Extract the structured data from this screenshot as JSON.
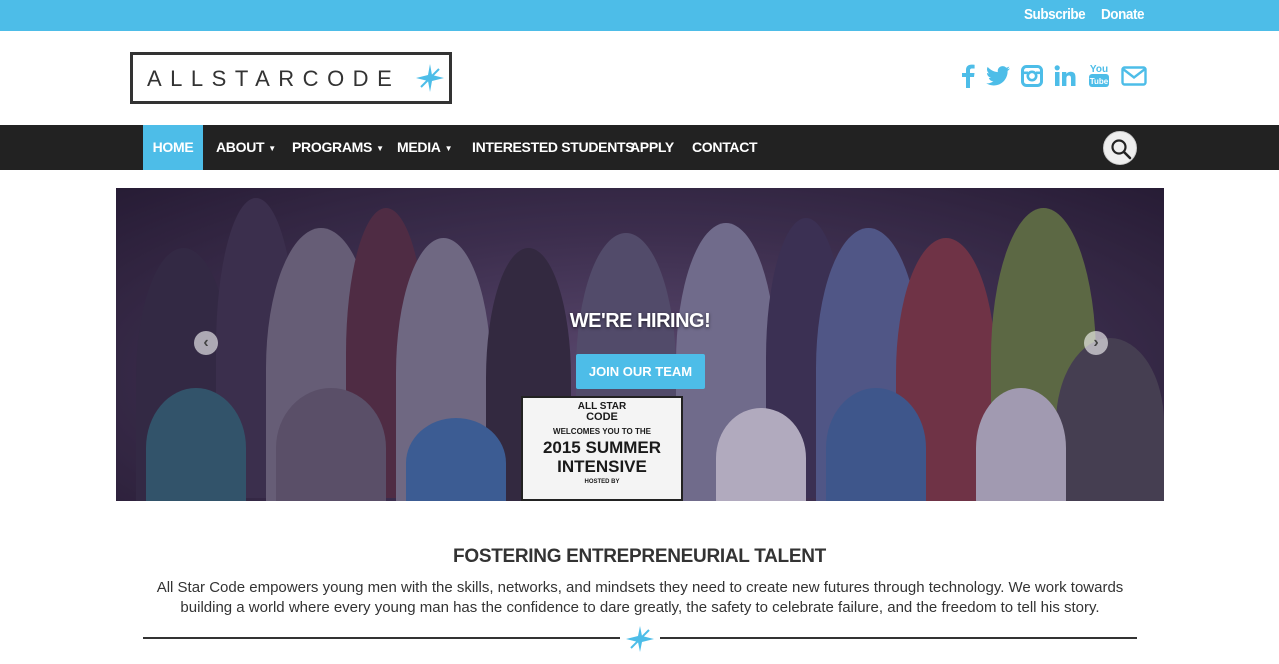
{
  "topbar": {
    "subscribe": "Subscribe",
    "donate": "Donate"
  },
  "logo": {
    "text": "ALLSTARCODE"
  },
  "social": [
    "facebook",
    "twitter",
    "instagram",
    "linkedin",
    "youtube",
    "email"
  ],
  "nav": {
    "items": [
      {
        "label": "Home",
        "active": true
      },
      {
        "label": "About",
        "dropdown": true
      },
      {
        "label": "Programs",
        "dropdown": true
      },
      {
        "label": "Media",
        "dropdown": true
      },
      {
        "label": "Interested Students"
      },
      {
        "label": "Apply"
      },
      {
        "label": "Contact"
      }
    ]
  },
  "hero": {
    "title": "WE'RE HIRING!",
    "button": "JOIN OUR TEAM",
    "sign": {
      "brand_top": "ALL STAR",
      "brand_bottom": "CODE",
      "welcome": "WELCOMES YOU TO THE",
      "line1": "2015 SUMMER",
      "line2": "INTENSIVE",
      "hosted": "HOSTED BY"
    }
  },
  "section": {
    "title": "FOSTERING ENTREPRENEURIAL TALENT",
    "body": "All Star Code empowers young men with the skills, networks, and mindsets they need to create new futures through technology. We work towards building a world where every young man has the confidence to dare greatly, the safety to celebrate failure, and the freedom to tell his story."
  },
  "colors": {
    "accent": "#4dbde8",
    "dark": "#222222",
    "text": "#333333"
  }
}
